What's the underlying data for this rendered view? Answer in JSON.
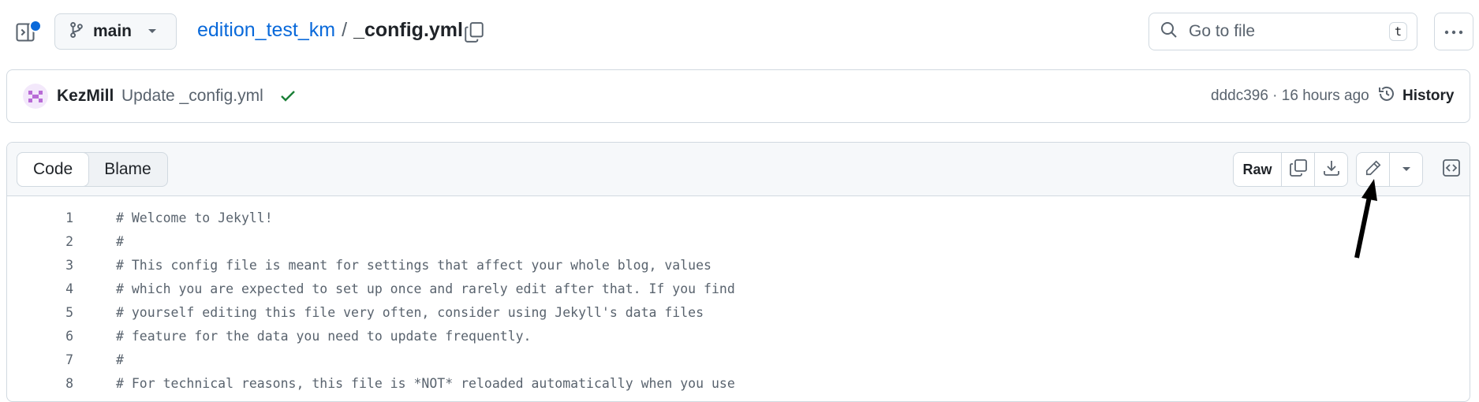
{
  "branch": {
    "name": "main"
  },
  "breadcrumb": {
    "repo": "edition_test_km",
    "separator": "/",
    "file": "_config.yml"
  },
  "search": {
    "placeholder": "Go to file",
    "shortcut": "t"
  },
  "commit": {
    "author": "KezMill",
    "message": "Update _config.yml",
    "meta": "dddc396 · 16 hours ago",
    "history_label": "History"
  },
  "file_view": {
    "tabs": [
      {
        "label": "Code",
        "active": true
      },
      {
        "label": "Blame",
        "active": false
      }
    ],
    "raw_label": "Raw"
  },
  "code_lines": [
    {
      "num": "1",
      "text": "# Welcome to Jekyll!"
    },
    {
      "num": "2",
      "text": "#"
    },
    {
      "num": "3",
      "text": "# This config file is meant for settings that affect your whole blog, values"
    },
    {
      "num": "4",
      "text": "# which you are expected to set up once and rarely edit after that. If you find"
    },
    {
      "num": "5",
      "text": "# yourself editing this file very often, consider using Jekyll's data files"
    },
    {
      "num": "6",
      "text": "# feature for the data you need to update frequently."
    },
    {
      "num": "7",
      "text": "#"
    },
    {
      "num": "8",
      "text": "# For technical reasons, this file is *NOT* reloaded automatically when you use"
    }
  ],
  "icons": {
    "sidebar": "sidebar-toggle-icon",
    "branch": "git-branch-icon",
    "copy": "copy-icon",
    "search": "search-icon",
    "more": "kebab-horizontal-icon",
    "check": "check-icon",
    "history": "history-icon",
    "download": "download-icon",
    "edit": "pencil-icon",
    "dropdown": "triangle-down-icon",
    "symbols": "code-square-icon"
  },
  "colors": {
    "link": "#0969da",
    "success": "#1a7f37",
    "border": "#d1d9e0",
    "muted": "#59636e"
  }
}
